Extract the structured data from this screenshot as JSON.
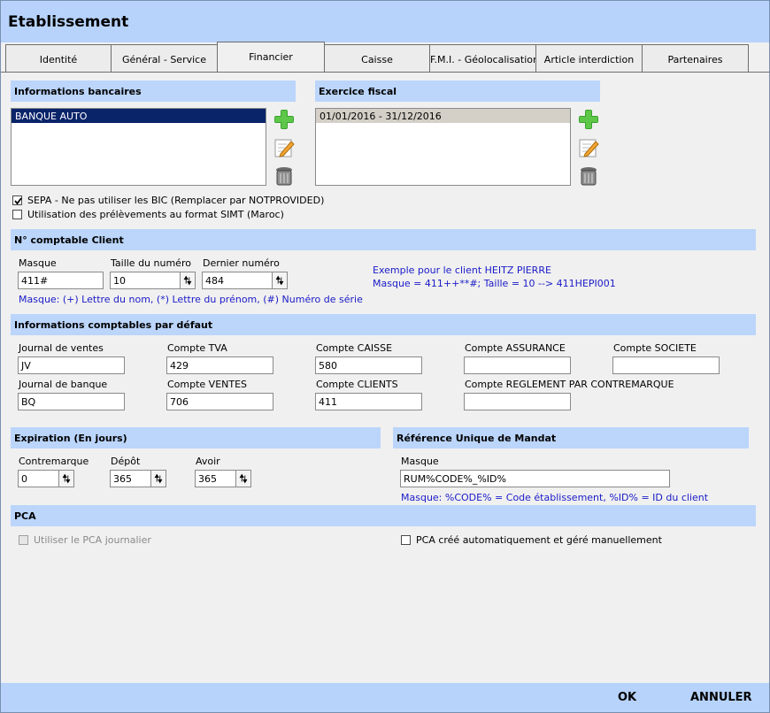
{
  "window": {
    "title": "Etablissement"
  },
  "tabs": [
    {
      "label": "Identité"
    },
    {
      "label": "Général - Service"
    },
    {
      "label": "Financier"
    },
    {
      "label": "Caisse"
    },
    {
      "label": "F.M.I. - Géolocalisation"
    },
    {
      "label": "Article interdiction"
    },
    {
      "label": "Partenaires"
    }
  ],
  "bank": {
    "header": "Informations bancaires",
    "items": [
      "BANQUE AUTO"
    ]
  },
  "fiscal": {
    "header": "Exercice fiscal",
    "items": [
      "01/01/2016 - 31/12/2016"
    ]
  },
  "icons": {
    "add": "plus-icon",
    "edit": "pencil-icon",
    "delete": "trash-icon"
  },
  "checks": {
    "sepa": {
      "label": "SEPA - Ne pas utiliser les BIC (Remplacer par NOTPROVIDED)",
      "checked": true
    },
    "simt": {
      "label": "Utilisation des prélèvements au format SIMT (Maroc)",
      "checked": false
    }
  },
  "client_account": {
    "header": "N° comptable Client",
    "masque_label": "Masque",
    "masque_value": "411#",
    "taille_label": "Taille du numéro",
    "taille_value": "10",
    "dernier_label": "Dernier numéro",
    "dernier_value": "484",
    "help": "Masque: (+) Lettre du nom, (*) Lettre du prénom, (#) Numéro de série",
    "example_line1": "Exemple pour le client HEITZ PIERRE",
    "example_line2": "Masque = 411++**#; Taille = 10 --> 411HEPI001"
  },
  "defaults": {
    "header": "Informations comptables par défaut",
    "journal_ventes_label": "Journal de ventes",
    "journal_ventes_value": "JV",
    "compte_tva_label": "Compte TVA",
    "compte_tva_value": "429",
    "compte_caisse_label": "Compte CAISSE",
    "compte_caisse_value": "580",
    "compte_assurance_label": "Compte ASSURANCE",
    "compte_assurance_value": "",
    "compte_societe_label": "Compte SOCIETE",
    "compte_societe_value": "",
    "journal_banque_label": "Journal de banque",
    "journal_banque_value": "BQ",
    "compte_ventes_label": "Compte VENTES",
    "compte_ventes_value": "706",
    "compte_clients_label": "Compte CLIENTS",
    "compte_clients_value": "411",
    "compte_reglement_label": "Compte REGLEMENT PAR CONTREMARQUE",
    "compte_reglement_value": ""
  },
  "expiration": {
    "header": "Expiration (En jours)",
    "contremarque_label": "Contremarque",
    "contremarque_value": "0",
    "depot_label": "Dépôt",
    "depot_value": "365",
    "avoir_label": "Avoir",
    "avoir_value": "365"
  },
  "rum": {
    "header": "Référence Unique de Mandat",
    "masque_label": "Masque",
    "masque_value": "RUM%CODE%_%ID%",
    "help": "Masque: %CODE% = Code établissement, %ID% = ID du client"
  },
  "pca": {
    "header": "PCA",
    "journalier_label": "Utiliser le PCA journalier",
    "auto_label": "PCA créé automatiquement et géré manuellement"
  },
  "footer": {
    "ok": "OK",
    "cancel": "ANNULER"
  },
  "colors": {
    "header_bg": "#bbd5fb",
    "title_bg": "#b7d3fb",
    "selection": "#0a246a",
    "help_text": "#1a1ac8"
  }
}
